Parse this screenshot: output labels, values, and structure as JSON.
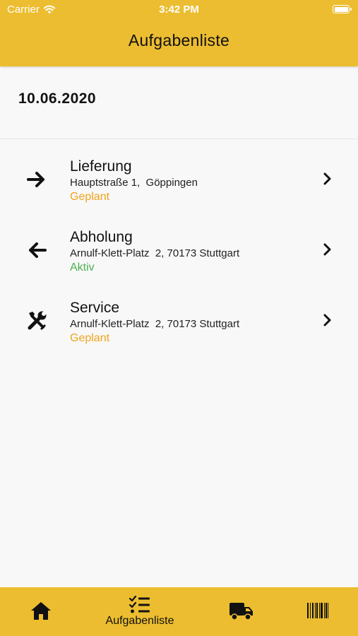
{
  "status_bar": {
    "carrier": "Carrier",
    "time": "3:42 PM"
  },
  "header": {
    "title": "Aufgabenliste"
  },
  "date": "10.06.2020",
  "tasks": [
    {
      "icon": "arrow-right-icon",
      "title": "Lieferung",
      "address": "Hauptstraße 1,  Göppingen",
      "status": "Geplant",
      "status_color": "#f0a41c"
    },
    {
      "icon": "arrow-left-icon",
      "title": "Abholung",
      "address": "Arnulf-Klett-Platz  2, 70173 Stuttgart",
      "status": "Aktiv",
      "status_color": "#4caf50"
    },
    {
      "icon": "tools-icon",
      "title": "Service",
      "address": "Arnulf-Klett-Platz  2, 70173 Stuttgart",
      "status": "Geplant",
      "status_color": "#f0a41c"
    }
  ],
  "tabbar": {
    "items": [
      {
        "icon": "home-icon",
        "label": ""
      },
      {
        "icon": "checklist-icon",
        "label": "Aufgabenliste"
      },
      {
        "icon": "truck-icon",
        "label": ""
      },
      {
        "icon": "barcode-icon",
        "label": ""
      }
    ]
  },
  "colors": {
    "accent": "#ecbd30",
    "planned": "#f0a41c",
    "active": "#4caf50"
  }
}
